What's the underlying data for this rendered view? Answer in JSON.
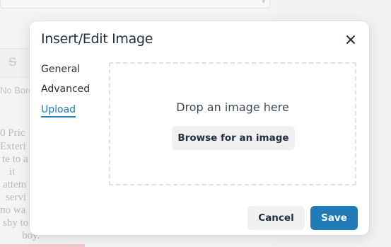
{
  "background": {
    "toolbar_placeholder": "No Border",
    "strike_glyph": "S",
    "text_lines": [
      "0  Pric",
      "Exteri",
      "te to a",
      "it",
      "attem",
      "servi",
      "no  wa",
      "shy to",
      "boy."
    ]
  },
  "dialog": {
    "title": "Insert/Edit Image",
    "close_icon": "close-icon",
    "tabs": [
      {
        "label": "General",
        "active": false
      },
      {
        "label": "Advanced",
        "active": false
      },
      {
        "label": "Upload",
        "active": true
      }
    ],
    "dropzone": {
      "text": "Drop an image here",
      "browse_label": "Browse for an image"
    },
    "footer": {
      "cancel_label": "Cancel",
      "save_label": "Save"
    }
  },
  "colors": {
    "accent": "#207ab7",
    "text": "#222f3e",
    "button_secondary": "#f0f0f0"
  }
}
